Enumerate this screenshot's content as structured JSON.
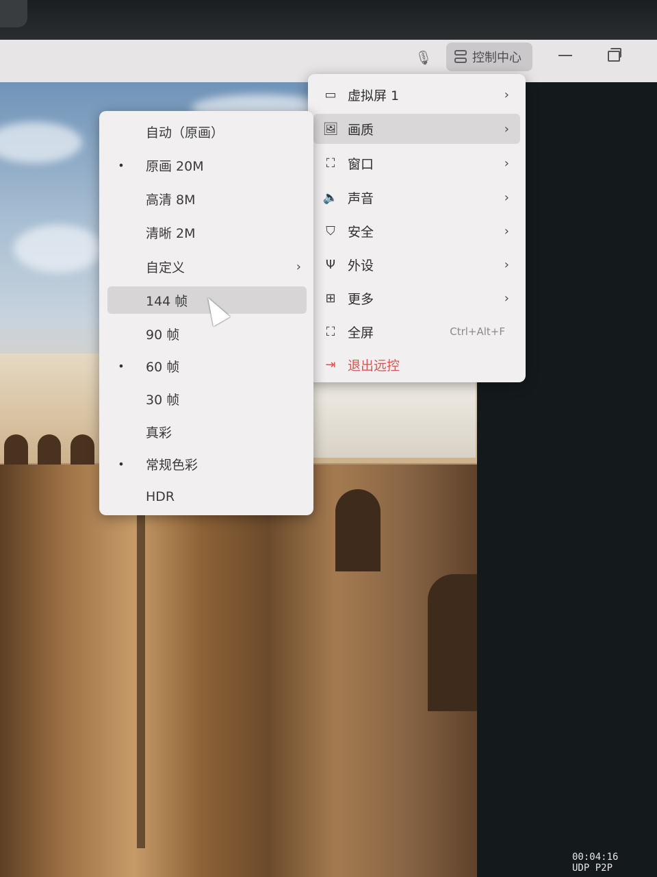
{
  "titlebar": {
    "control_center_label": "控制中心"
  },
  "main_menu": {
    "items": [
      {
        "icon": "monitor-icon",
        "label": "虚拟屏 1",
        "has_submenu": true
      },
      {
        "icon": "image-quality-icon",
        "label": "画质",
        "has_submenu": true,
        "highlighted": true
      },
      {
        "icon": "window-frame-icon",
        "label": "窗口",
        "has_submenu": true
      },
      {
        "icon": "speaker-icon",
        "label": "声音",
        "has_submenu": true
      },
      {
        "icon": "shield-icon",
        "label": "安全",
        "has_submenu": true
      },
      {
        "icon": "usb-icon",
        "label": "外设",
        "has_submenu": true
      },
      {
        "icon": "grid-icon",
        "label": "更多",
        "has_submenu": true
      },
      {
        "icon": "fullscreen-icon",
        "label": "全屏",
        "shortcut": "Ctrl+Alt+F"
      },
      {
        "icon": "exit-icon",
        "label": "退出远控",
        "color": "#d8564f"
      }
    ]
  },
  "quality_submenu": {
    "items": [
      {
        "label": "自动（原画）",
        "checked": false
      },
      {
        "label": "原画 20M",
        "checked": true
      },
      {
        "label": "高清 8M",
        "checked": false
      },
      {
        "label": "清晰 2M",
        "checked": false
      },
      {
        "label": "自定义",
        "checked": false,
        "has_submenu": true
      },
      {
        "label": "144 帧",
        "checked": false,
        "highlighted": true
      },
      {
        "label": "90 帧",
        "checked": false
      },
      {
        "label": "60 帧",
        "checked": true
      },
      {
        "label": "30 帧",
        "checked": false
      },
      {
        "label": "真彩",
        "checked": false
      },
      {
        "label": "常规色彩",
        "checked": true
      },
      {
        "label": "HDR",
        "checked": false
      }
    ]
  },
  "overlay": {
    "timer": "00:04:16",
    "connection": "UDP P2P"
  },
  "colors": {
    "menu_bg": "#f1eff0",
    "highlight": "#d9d7d8",
    "exit_red": "#d8564f"
  }
}
